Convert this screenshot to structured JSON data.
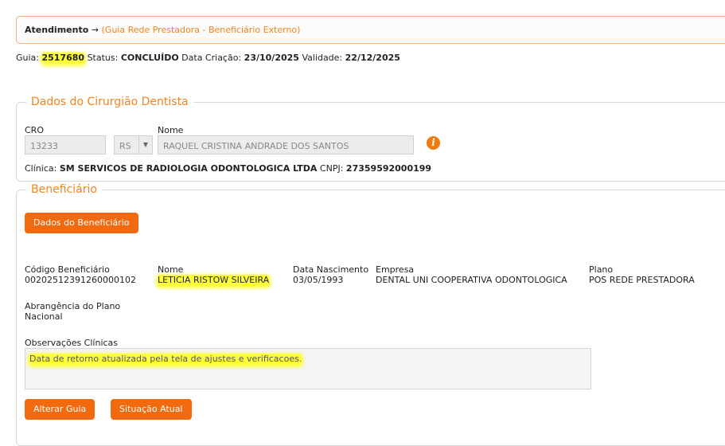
{
  "breadcrumb": {
    "title": "Atendimento",
    "arrow": "→",
    "subtitle": "(Guia Rede Prestadora - Beneficiário Externo)"
  },
  "guia": {
    "guia_label": "Guia:",
    "guia_number": "2517680",
    "status_label": "Status:",
    "status_value": "CONCLUÍDO",
    "created_label": "Data Criação:",
    "created_value": "23/10/2025",
    "validity_label": "Validade:",
    "validity_value": "22/12/2025"
  },
  "dentista": {
    "legend": "Dados do Cirurgião Dentista",
    "cro_label": "CRO",
    "cro_value": "13233",
    "uf_value": "RS",
    "name_label": "Nome",
    "name_value": "RAQUEL CRISTINA ANDRADE DOS SANTOS",
    "info_icon": "i",
    "clinic_label": "Clínica:",
    "clinic_value": "SM SERVICOS DE RADIOLOGIA ODONTOLOGICA LTDA",
    "cnpj_label": "CNPJ:",
    "cnpj_value": "27359592000199"
  },
  "beneficiario": {
    "legend": "Beneficiário",
    "details_button": "Dados do Beneficiário",
    "codigo_label": "Código Beneficiário",
    "codigo_value": "00202512391260000102",
    "nome_label": "Nome",
    "nome_value": "LETICIA RISTOW SILVEIRA",
    "nasc_label": "Data Nascimento",
    "nasc_value": "03/05/1993",
    "empresa_label": "Empresa",
    "empresa_value": "DENTAL UNI COOPERATIVA ODONTOLOGICA",
    "plano_label": "Plano",
    "plano_value": "POS REDE PRESTADORA",
    "abrangencia_label": "Abrangência do Plano",
    "abrangencia_value": "Nacional",
    "obs_label": "Observações Clínicas",
    "obs_value": "Data de retorno atualizada pela tela de ajustes e verificacoes."
  },
  "actions": {
    "alterar": "Alterar Guia",
    "situacao": "Situação Atual"
  },
  "colors": {
    "accent": "#f26a10",
    "legend": "#f0841e",
    "highlight": "#ffff3a"
  }
}
